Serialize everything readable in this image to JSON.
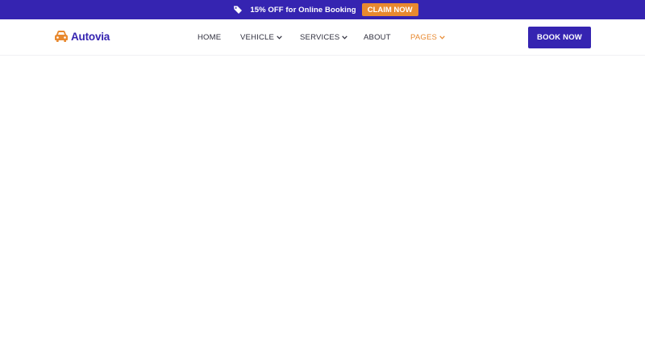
{
  "promo": {
    "icon": "tag-icon",
    "text": "15% OFF for Online Booking",
    "cta_label": "CLAIM NOW"
  },
  "brand": {
    "icon": "car-icon",
    "name": "Autovia"
  },
  "nav": {
    "items": [
      {
        "label": "HOME",
        "dropdown": false,
        "active": false
      },
      {
        "label": "VEHICLE",
        "dropdown": true,
        "active": false
      },
      {
        "label": "SERVICES",
        "dropdown": true,
        "active": false
      },
      {
        "label": "ABOUT",
        "dropdown": false,
        "active": false
      },
      {
        "label": "PAGES",
        "dropdown": true,
        "active": true
      }
    ]
  },
  "header": {
    "cta_label": "BOOK NOW"
  },
  "colors": {
    "primary": "#3524b1",
    "accent": "#e8892f",
    "background": "#ffffff"
  }
}
